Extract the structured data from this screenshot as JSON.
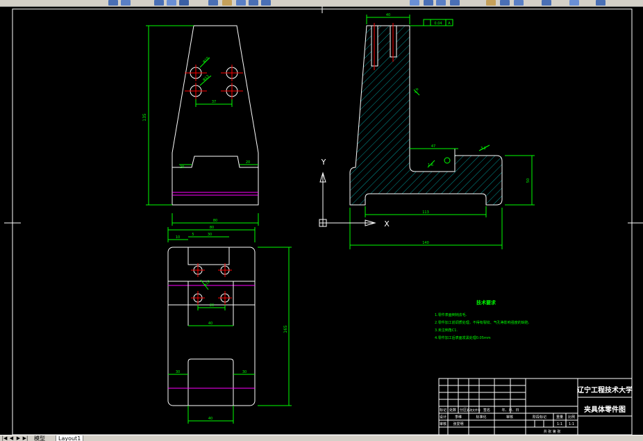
{
  "tabs": {
    "model": "模型",
    "layout1": "Layout1"
  },
  "axis": {
    "y": "Y",
    "x": "X"
  },
  "front_view": {
    "height_dim": "135",
    "hole_dia_top": "Φ10",
    "hole_dia_mid": "Φ13",
    "hole_spacing": "37",
    "slot_depth": "20",
    "slot_right": "20",
    "bottom_width": "80"
  },
  "top_view": {
    "dim_left": "10",
    "dim_mid": "5",
    "dim_right": "30",
    "hole_spacing": "20",
    "angle_dim": "Φ10",
    "inner_width": "40",
    "total_height": "165",
    "notch_dim": "30",
    "bottom_width": "40"
  },
  "side_view": {
    "top_width": "40",
    "tol_label": "0.04",
    "tol_ref": "A",
    "slope_label": "1.6",
    "inner_step": "47",
    "roughness_1": "1.6",
    "roughness_2": "3.2",
    "right_height": "50",
    "inner_length": "113",
    "total_length": "140"
  },
  "notes": {
    "title": "技术要求",
    "items": [
      "1.零件表面倒钝去毛.",
      "2.零件加工前调质处理，不得有裂纹、气孔等影响强度的缺陷.",
      "3.未注倒角C1.",
      "4.零件加工后表面发黑处理0.05mm"
    ]
  },
  "title_block": {
    "school": "辽宁工程技术大学",
    "part_name": "夹具体零件图",
    "stage_header": "阶段标记",
    "weight_header": "重量",
    "scale_header": "比例",
    "scale": "1:1",
    "scale2": "1:1",
    "row_labels": [
      "标记",
      "处数",
      "分区",
      "更改文件号",
      "签名",
      "年、月、日"
    ],
    "row2_labels": [
      "设计",
      "李维",
      "标准化",
      "审核"
    ],
    "row3_labels": [
      "审核",
      "张爱明"
    ],
    "sheet": "共 张 第 张"
  },
  "colors": {
    "outline": "#ffffff",
    "dimension": "#00ff00",
    "centerline": "#ff0000",
    "hidden": "#ff00ff",
    "hatch": "#00bfbf",
    "hole": "#ffff00"
  }
}
